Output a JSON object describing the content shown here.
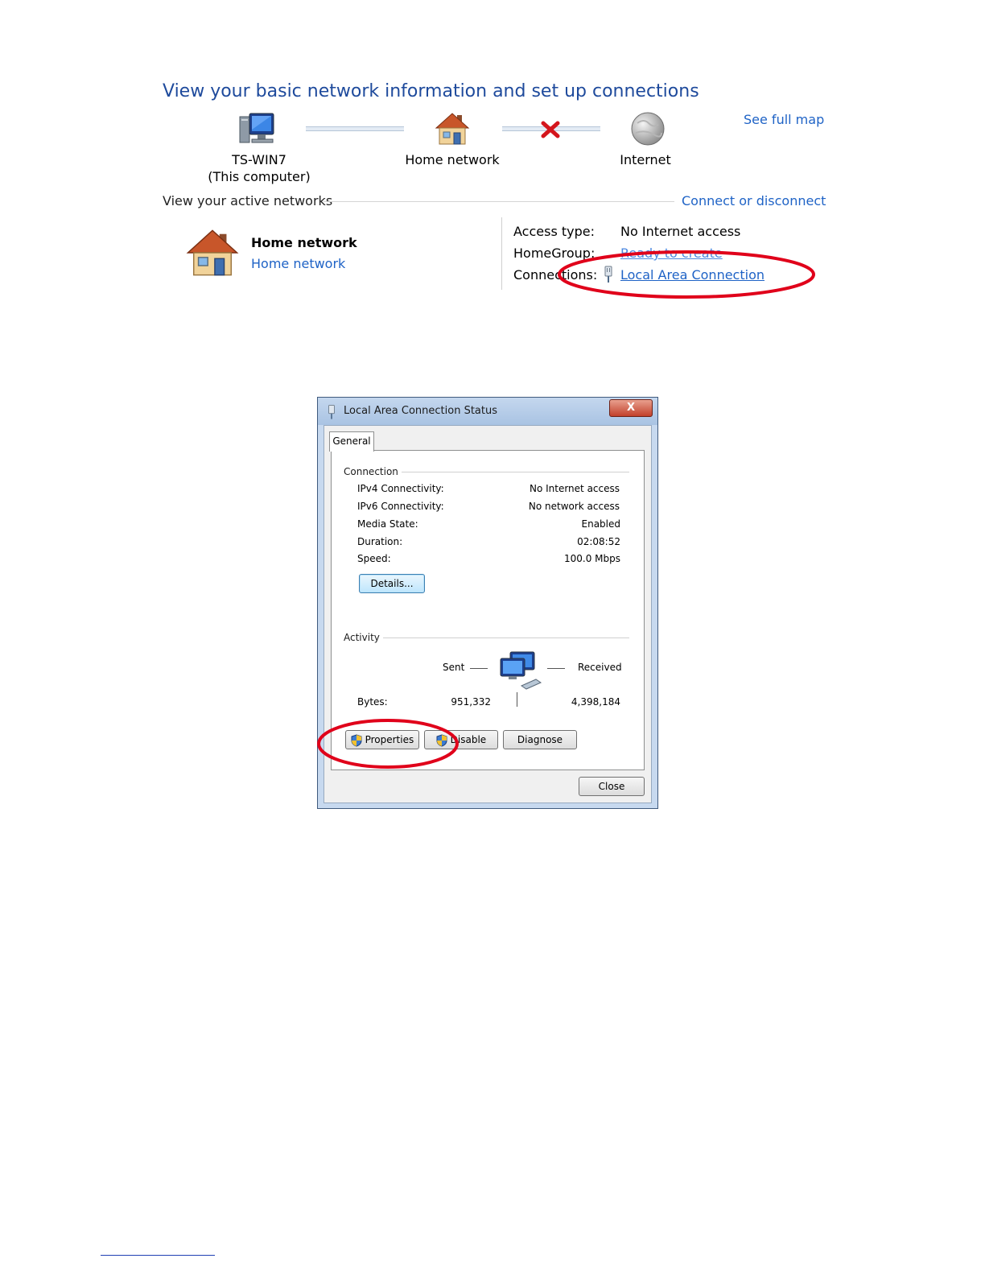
{
  "nsc": {
    "title": "View your basic network information and set up connections",
    "see_full_map": "See full map",
    "map": {
      "computer_name": "TS-WIN7",
      "computer_sub": "(This computer)",
      "network_label": "Home network",
      "internet_label": "Internet"
    },
    "active_header": "View your active networks",
    "connect_or_disconnect": "Connect or disconnect",
    "active_network": {
      "name": "Home network",
      "type": "Home network"
    },
    "properties": {
      "access_type_label": "Access type:",
      "access_type_value": "No Internet access",
      "homegroup_label": "HomeGroup:",
      "homegroup_value": "Ready to create",
      "connections_label": "Connections:",
      "connections_value": "Local Area Connection"
    }
  },
  "dialog": {
    "title": "Local Area Connection Status",
    "close_glyph": "X",
    "tab_general": "General",
    "connection_group": "Connection",
    "rows": [
      {
        "label": "IPv4 Connectivity:",
        "value": "No Internet access"
      },
      {
        "label": "IPv6 Connectivity:",
        "value": "No network access"
      },
      {
        "label": "Media State:",
        "value": "Enabled"
      },
      {
        "label": "Duration:",
        "value": "02:08:52"
      },
      {
        "label": "Speed:",
        "value": "100.0 Mbps"
      }
    ],
    "details_button": "Details...",
    "activity_group": "Activity",
    "sent_label": "Sent",
    "received_label": "Received",
    "bytes_label": "Bytes:",
    "bytes_sent": "951,332",
    "bytes_received": "4,398,184",
    "properties_button": "Properties",
    "disable_button": "Disable",
    "diagnose_button": "Diagnose",
    "close_button": "Close"
  },
  "colors": {
    "title_blue": "#1e4a9c",
    "link_blue": "#1f63c6",
    "annotation_red": "#e0001a"
  },
  "icons": [
    "computer-icon",
    "house-icon",
    "globe-icon",
    "red-x-icon",
    "cable-icon",
    "shield-icon",
    "network-computers-icon"
  ]
}
